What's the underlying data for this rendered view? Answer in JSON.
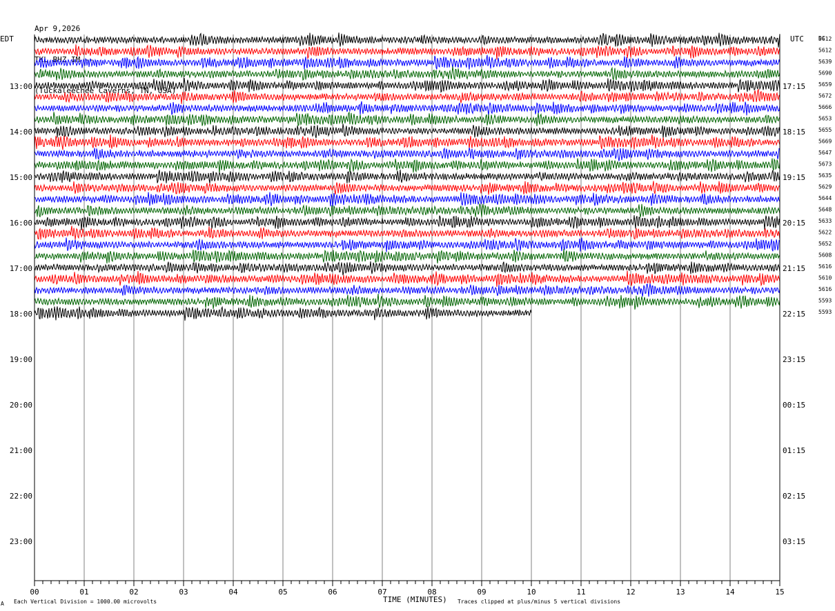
{
  "header": {
    "date": "Apr 9,2026",
    "station": "TKL BHZ IM --",
    "location": "(Tuckaleechee Caverns, TN, USA)"
  },
  "left_timezone": "EDT",
  "right_timezone": "UTC",
  "dc_label": "DC",
  "footer": {
    "xlabel": "TIME (MINUTES)",
    "scale_note": "Each Vertical Division = 1000.00 microvolts",
    "clip_note": "Traces clipped at plus/minus 5 vertical divisions",
    "corner_mark": "A"
  },
  "colors": {
    "trace_cycle": [
      "#000000",
      "#ff0000",
      "#0000ff",
      "#006400"
    ],
    "grid": "#808080"
  },
  "chart_data": {
    "type": "line",
    "title": "TKL BHZ IM --",
    "xlabel": "TIME (MINUTES)",
    "x_ticks": [
      "00",
      "01",
      "02",
      "03",
      "04",
      "05",
      "06",
      "07",
      "08",
      "09",
      "10",
      "11",
      "12",
      "13",
      "14",
      "15"
    ],
    "xlim": [
      0,
      15
    ],
    "left_hour_labels": [
      "13:00",
      "14:00",
      "15:00",
      "16:00",
      "17:00",
      "18:00",
      "19:00",
      "20:00",
      "21:00",
      "22:00",
      "23:00"
    ],
    "right_hour_labels": [
      "17:15",
      "18:15",
      "19:15",
      "20:15",
      "21:15",
      "22:15",
      "23:15",
      "00:15",
      "01:15",
      "02:15",
      "03:15"
    ],
    "rows_per_hour": 4,
    "total_rows": 48,
    "first_row_start_edt": "12:00",
    "traces_shown": 25,
    "last_trace_minutes": 10,
    "dc_offsets": [
      5612,
      5612,
      5639,
      5690,
      5659,
      5672,
      5666,
      5653,
      5655,
      5669,
      5647,
      5673,
      5635,
      5629,
      5644,
      5648,
      5633,
      5622,
      5652,
      5608,
      5616,
      5610,
      5616,
      5593,
      5593
    ]
  }
}
